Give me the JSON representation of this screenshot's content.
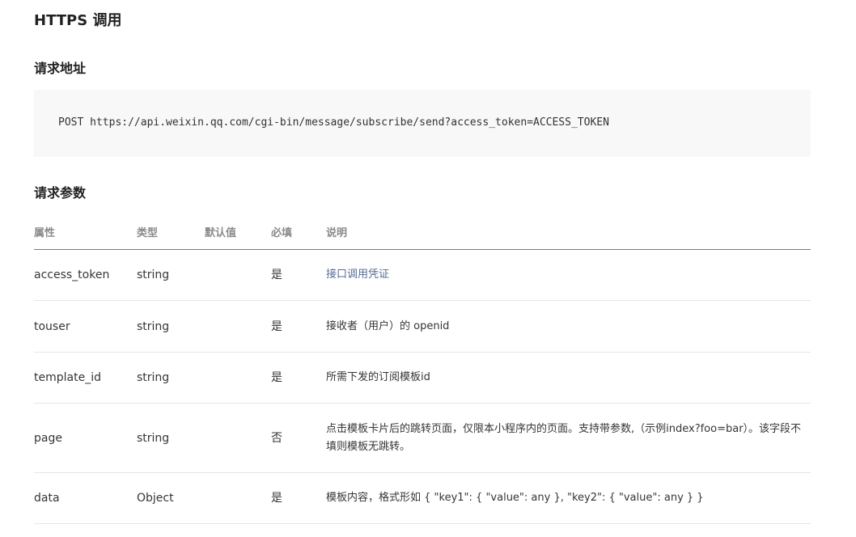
{
  "doc": {
    "title": "HTTPS 调用",
    "request_address": {
      "heading": "请求地址",
      "code": "POST https://api.weixin.qq.com/cgi-bin/message/subscribe/send?access_token=ACCESS_TOKEN"
    },
    "request_params": {
      "heading": "请求参数",
      "headers": {
        "property": "属性",
        "type": "类型",
        "default": "默认值",
        "required": "必填",
        "description": "说明"
      },
      "rows": [
        {
          "property": "access_token",
          "type": "string",
          "default": "",
          "required": "是",
          "description": "接口调用凭证"
        },
        {
          "property": "touser",
          "type": "string",
          "default": "",
          "required": "是",
          "description": "接收者（用户）的 openid"
        },
        {
          "property": "template_id",
          "type": "string",
          "default": "",
          "required": "是",
          "description": "所需下发的订阅模板id"
        },
        {
          "property": "page",
          "type": "string",
          "default": "",
          "required": "否",
          "description": "点击模板卡片后的跳转页面，仅限本小程序内的页面。支持带参数,（示例index?foo=bar）。该字段不填则模板无跳转。"
        },
        {
          "property": "data",
          "type": "Object",
          "default": "",
          "required": "是",
          "description": "模板内容，格式形如 { \"key1\": { \"value\": any }, \"key2\": { \"value\": any } }"
        }
      ]
    }
  },
  "colors": {
    "link": "#576b95",
    "code_background": "#f8f8f8",
    "header_text": "#8a8a8a"
  }
}
